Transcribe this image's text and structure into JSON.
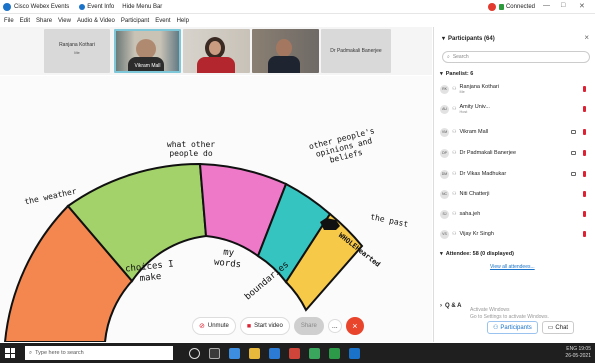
{
  "titlebar": {
    "app_title": "Cisco Webex Events",
    "event_info": "Event Info",
    "hide_menu_bar": "Hide Menu Bar",
    "connection_status": "Connected",
    "colors": {
      "record": "#e23a2e",
      "connected": "#2c9a3c",
      "brand": "#1a73c8"
    }
  },
  "menu": [
    "File",
    "Edit",
    "Share",
    "View",
    "Audio & Video",
    "Participant",
    "Event",
    "Help"
  ],
  "video_strip": {
    "tiles": [
      {
        "name": "Ranjana Kothari",
        "sub": "Me",
        "has_video": false
      },
      {
        "name": "Vikram Mall",
        "has_video": true
      },
      {
        "name": "",
        "has_video": true
      },
      {
        "name": "",
        "has_video": true
      },
      {
        "name": "Dr Padmakali Banerjee",
        "has_video": false
      }
    ]
  },
  "slide": {
    "labels": {
      "what_other": "what other people do",
      "other_opinions": "other people's opinions and beliefs",
      "weather": "the weather",
      "past": "the past",
      "choices": "choices I make",
      "my_words": "my words",
      "boundaries": "boundaries",
      "logo": "WHOLEHearted"
    },
    "segment_colors": [
      "#f4874f",
      "#a3d26a",
      "#ee79c9",
      "#36c4c0",
      "#f7c948"
    ]
  },
  "controls": {
    "unmute": "Unmute",
    "start_video": "Start video",
    "share": "Share",
    "more": "...",
    "end": "×"
  },
  "panel": {
    "title": "Participants (64)",
    "search_placeholder": "Search",
    "panelists_header": "Panelist: 6",
    "participants": [
      {
        "initials": "RK",
        "name": "Ranjana Kothari",
        "sub": "Me",
        "host": true
      },
      {
        "initials": "AU",
        "name": "Amity Univ...",
        "sub": "Host",
        "host": true
      },
      {
        "initials": "VM",
        "name": "Vikram Mall",
        "sub": "",
        "host": false
      },
      {
        "initials": "DP",
        "name": "Dr Padmakali Banerjee",
        "sub": "",
        "host": false
      },
      {
        "initials": "DM",
        "name": "Dr Vikas Madhukar",
        "sub": "",
        "host": false
      },
      {
        "initials": "NC",
        "name": "Niti Chatterji",
        "sub": "",
        "host": false
      },
      {
        "initials": "SJ",
        "name": "saha.jeh",
        "sub": "",
        "host": false
      },
      {
        "initials": "VS",
        "name": "Vijay Kr Singh",
        "sub": "",
        "host": false
      }
    ],
    "attendees_header": "Attendee: 58 (0 displayed)",
    "view_all": "View all attendees...",
    "qa_header": "Q & A"
  },
  "watermark": {
    "line1": "Activate Windows",
    "line2": "Go to Settings to activate Windows."
  },
  "bottom_tabs": {
    "participants": "Participants",
    "chat": "Chat"
  },
  "taskbar": {
    "search_placeholder": "Type here to search",
    "time": "19:05",
    "date": "26-05-2021",
    "lang": "ENG"
  }
}
